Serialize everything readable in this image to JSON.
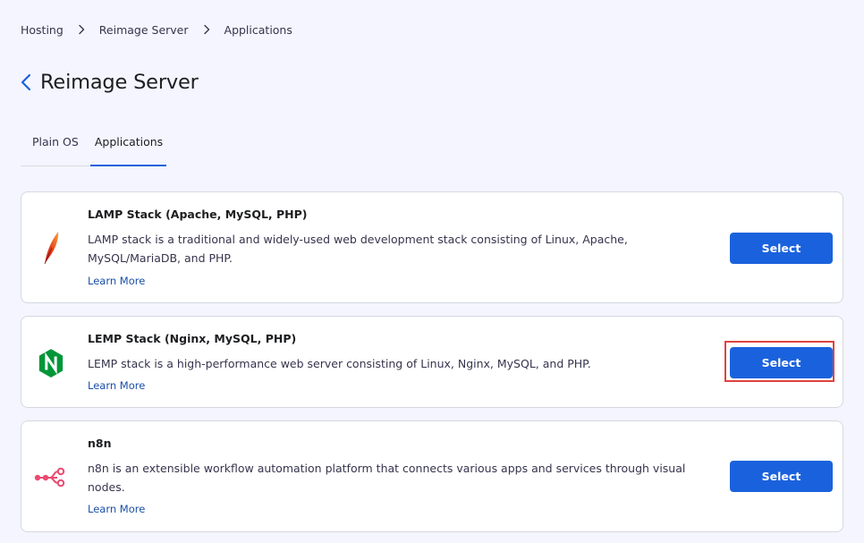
{
  "breadcrumb": {
    "items": [
      "Hosting",
      "Reimage Server",
      "Applications"
    ]
  },
  "header": {
    "title": "Reimage Server"
  },
  "tabs": [
    {
      "label": "Plain OS",
      "active": false
    },
    {
      "label": "Applications",
      "active": true
    }
  ],
  "apps": [
    {
      "title": "LAMP Stack (Apache, MySQL, PHP)",
      "description": "LAMP stack is a traditional and widely-used web development stack consisting of Linux, Apache, MySQL/MariaDB, and PHP.",
      "link": "Learn More",
      "button": "Select",
      "icon": "apache-feather-icon"
    },
    {
      "title": "LEMP Stack (Nginx, MySQL, PHP)",
      "description": "LEMP stack is a high-performance web server consisting of Linux, Nginx, MySQL, and PHP.",
      "link": "Learn More",
      "button": "Select",
      "icon": "nginx-logo-icon",
      "highlighted": true
    },
    {
      "title": "n8n",
      "description": "n8n is an extensible workflow automation platform that connects various apps and services through visual nodes.",
      "link": "Learn More",
      "button": "Select",
      "icon": "n8n-logo-icon"
    }
  ],
  "colors": {
    "accent": "#1a62dd",
    "highlight": "#e0433f",
    "nginx": "#009639",
    "n8n": "#ea4b71"
  }
}
